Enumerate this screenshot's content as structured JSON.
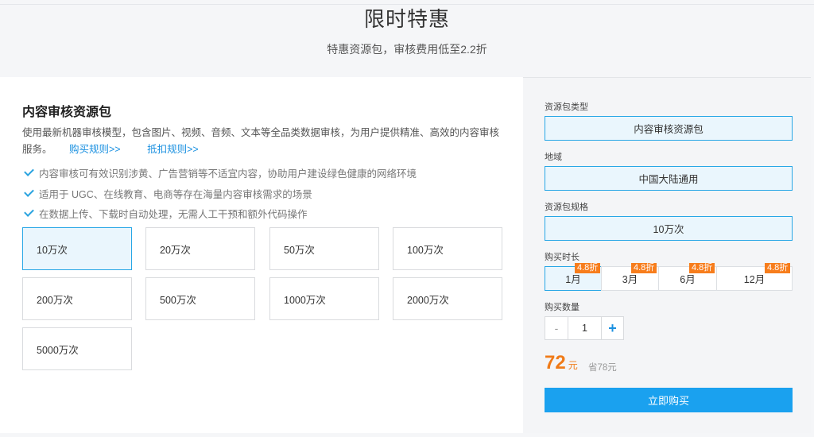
{
  "header": {
    "title": "限时特惠",
    "subtitle": "特惠资源包，审核费用低至2.2折"
  },
  "package": {
    "title": "内容审核资源包",
    "description": "使用最新机器审核模型，包含图片、视频、音频、文本等全品类数据审核，为用户提供精准、高效的内容审核服务。",
    "links": [
      "购买规则>>",
      "抵扣规则>>"
    ],
    "features": [
      "内容审核可有效识别涉黄、广告营销等不适宜内容，协助用户建设绿色健康的网络环境",
      "适用于 UGC、在线教育、电商等存在海量内容审核需求的场景",
      "在数据上传、下载时自动处理，无需人工干预和额外代码操作"
    ],
    "options": [
      "10万次",
      "20万次",
      "50万次",
      "100万次",
      "200万次",
      "500万次",
      "1000万次",
      "2000万次",
      "5000万次"
    ],
    "selected_option": "10万次"
  },
  "order": {
    "type_label": "资源包类型",
    "type_value": "内容审核资源包",
    "region_label": "地域",
    "region_value": "中国大陆通用",
    "spec_label": "资源包规格",
    "spec_value": "10万次",
    "duration_label": "购买时长",
    "durations": [
      {
        "label": "1月",
        "badge": "4.8折"
      },
      {
        "label": "3月",
        "badge": "4.8折"
      },
      {
        "label": "6月",
        "badge": "4.8折"
      },
      {
        "label": "12月",
        "badge": "4.8折"
      }
    ],
    "selected_duration": "1月",
    "quantity_label": "购买数量",
    "quantity_minus": "-",
    "quantity": "1",
    "quantity_plus": "+",
    "price": "72",
    "price_unit": "元",
    "saving": "省78元",
    "buy_label": "立即购买",
    "accent_color": "#1aa1ef",
    "price_color": "#f07b18"
  }
}
